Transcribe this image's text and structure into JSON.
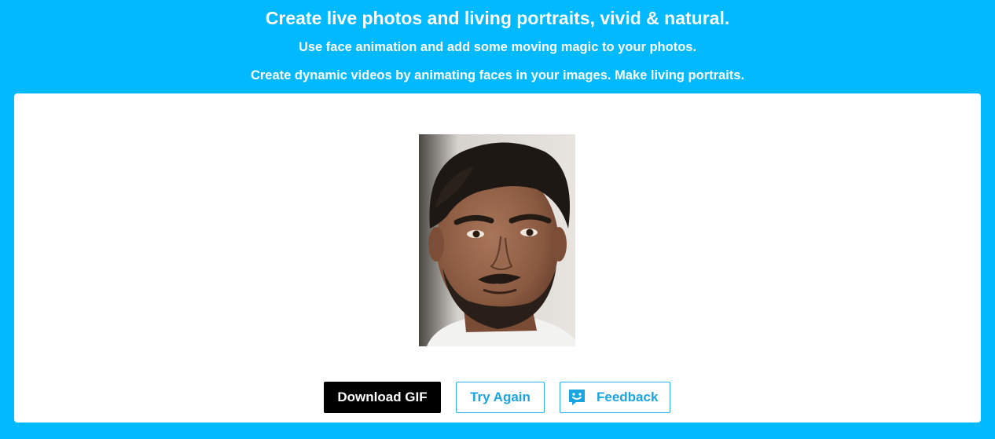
{
  "header": {
    "title": "Create live photos and living portraits, vivid & natural.",
    "subtitle_1": "Use face animation and add some moving magic to your photos.",
    "subtitle_2": "Create dynamic videos by animating faces in your images. Make living portraits."
  },
  "result": {
    "image_icon": "portrait-photo"
  },
  "actions": {
    "download_label": "Download GIF",
    "try_again_label": "Try Again",
    "feedback_label": "Feedback",
    "feedback_icon": "chat-smile-icon"
  },
  "colors": {
    "background": "#00b9ff",
    "panel": "#ffffff",
    "primary_button": "#000000",
    "accent": "#1aa5e0"
  }
}
